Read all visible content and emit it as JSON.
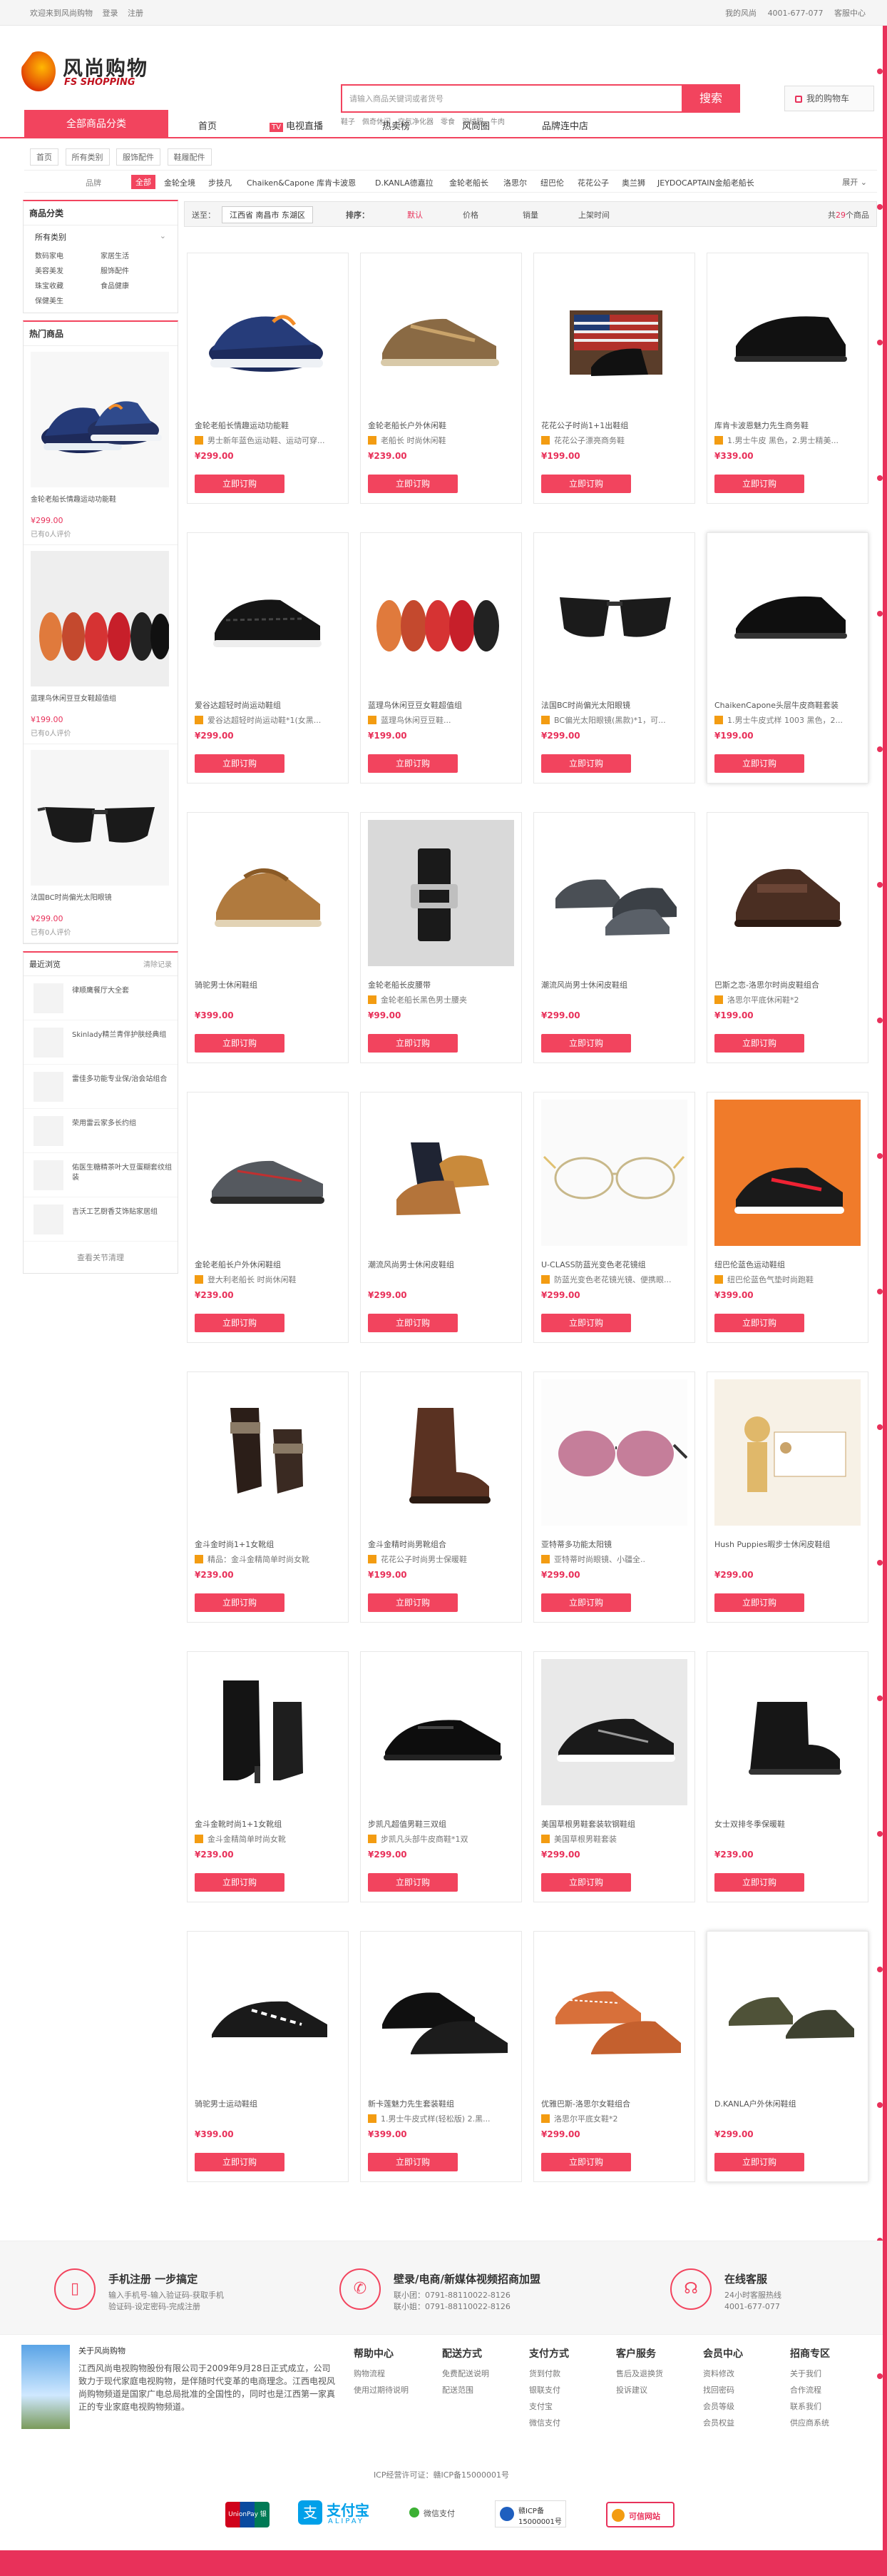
{
  "topbar": {
    "welcome": "欢迎来到风尚购物",
    "login": "登录",
    "register": "注册",
    "my_account": "我的风尚",
    "phone": "4001-677-077",
    "help": "客服中心"
  },
  "logo": {
    "cn": "风尚购物",
    "en": "FS SHOPPING"
  },
  "search": {
    "placeholder": "请输入商品关键词或者货号",
    "button": "搜索",
    "hot_words": [
      "鞋子",
      "佩奇休闲",
      "空气净化器",
      "零食",
      "羽绒服",
      "牛肉"
    ]
  },
  "cart": {
    "label": "我的购物车"
  },
  "nav": {
    "all_categories": "全部商品分类",
    "items": [
      "首页",
      "电视直播",
      "热卖榜",
      "风尚圈",
      "品牌连中店"
    ],
    "tv_badge": "TV"
  },
  "breadcrumb": [
    "首页",
    "所有类别",
    "服饰配件",
    "鞋履配件"
  ],
  "brands": {
    "label": "品牌",
    "selected": "全部",
    "items": [
      "金轮全境",
      "步技凡",
      "Chaiken&Capone 库肯卡波恩",
      "D.KANLA德嘉拉",
      "金轮老船长",
      "洛思尔",
      "纽巴伦",
      "花花公子",
      "奥兰狮",
      "JEYDOCAPTAIN金船老船长"
    ],
    "more": "展开"
  },
  "sidebar": {
    "category_title": "商品分类",
    "group": "所有类别",
    "links": [
      "数码家电",
      "家居生活",
      "美容美发",
      "服饰配件",
      "珠宝收藏",
      "食品健康",
      "保健美生"
    ],
    "hot_title": "热门商品",
    "hot_products": [
      {
        "name": "金轮老船长情趣运动功能鞋",
        "price": "¥299.00",
        "reviews": "已有0人评价"
      },
      {
        "name": "蓝理鸟休闲豆豆女鞋超值组",
        "price": "¥199.00",
        "reviews": "已有0人评价"
      },
      {
        "name": "法国BC时尚偏光太阳眼镜",
        "price": "¥299.00",
        "reviews": "已有0人评价"
      }
    ],
    "recent_title": "最近浏览",
    "recent_clear": "清除记录",
    "recent_items": [
      "律顺鹰餐厅大全套",
      "Skinlady精兰青伴护肤经典组",
      "雷佳多功能专业保/治会站组合",
      "荣用雷云家多长约组",
      "佑医生糖精茶叶大豆蛋糊套纹组装",
      "吉沃工艺厨香艾饰贴家居组"
    ],
    "recent_footer": "查看关节清理"
  },
  "sortbar": {
    "ship_to_label": "送至：",
    "location": "江西省 南昌市 东湖区",
    "sort_label": "排序：",
    "options": [
      "默认",
      "价格",
      "销量",
      "上架时间"
    ],
    "count_prefix": "共",
    "count": "29",
    "count_suffix": "个商品"
  },
  "buy_label": "立即订购",
  "products": [
    {
      "title": "金轮老船长情趣运动功能鞋",
      "tag": "男士新年蓝色运动鞋、运动可穿...",
      "price": "¥299.00"
    },
    {
      "title": "金轮老船长户外休闲鞋",
      "tag": "老船长 时尚休闲鞋",
      "price": "¥239.00"
    },
    {
      "title": "花花公子时尚1+1出鞋组",
      "tag": "花花公子漂亮商务鞋",
      "price": "¥199.00"
    },
    {
      "title": "库肯卡波恩魅力先生商务鞋",
      "tag": "1.男士牛皮 黑色，2.男士精美...",
      "price": "¥339.00"
    },
    {
      "title": "爱谷达超轻时尚运动鞋组",
      "tag": "爱谷达超轻时尚运动鞋*1(女黑...",
      "price": "¥299.00"
    },
    {
      "title": "蓝理鸟休闲豆豆女鞋超值组",
      "tag": "蓝理鸟休闲豆豆鞋...",
      "price": "¥199.00"
    },
    {
      "title": "法国BC时尚偏光太阳眼镜",
      "tag": "BC偏光太阳眼镜(黑款)*1，可...",
      "price": "¥299.00"
    },
    {
      "title": "ChaikenCapone头层牛皮商鞋套装",
      "tag": "1.男士牛皮式样 1003 黑色，2...",
      "price": "¥199.00"
    },
    {
      "title": "骑驼男士休闲鞋组",
      "tag": "",
      "price": "¥399.00"
    },
    {
      "title": "金轮老船长皮腰带",
      "tag": "金轮老船长黑色男士腰夹",
      "price": "¥99.00"
    },
    {
      "title": "潮流风尚男士休闲皮鞋组",
      "tag": "",
      "price": "¥299.00"
    },
    {
      "title": "巴斯之恋-洛思尔时尚皮鞋组合",
      "tag": "洛思尔平底休闲鞋*2",
      "price": "¥199.00"
    },
    {
      "title": "金轮老船长户外休闲鞋组",
      "tag": "登大利老船长 时尚休闲鞋",
      "price": "¥239.00"
    },
    {
      "title": "潮流风尚男士休闲皮鞋组",
      "tag": "",
      "price": "¥299.00"
    },
    {
      "title": "U-CLASS防蓝光变色老花镜组",
      "tag": "防蓝光变色老花镜光镜、便携眼...",
      "price": "¥299.00"
    },
    {
      "title": "纽巴伦蓝色运动鞋组",
      "tag": "纽巴伦蓝色气垫时尚跑鞋",
      "price": "¥399.00"
    },
    {
      "title": "金斗金时尚1+1女靴组",
      "tag": "精品：金斗金精简单时尚女靴",
      "price": "¥239.00"
    },
    {
      "title": "金斗金精时尚男靴组合",
      "tag": "花花公子时尚男士保暖鞋",
      "price": "¥199.00"
    },
    {
      "title": "亚特蒂多功能太阳镜",
      "tag": "亚特蒂时尚眼镜、小疆全..",
      "price": "¥299.00"
    },
    {
      "title": "Hush Puppies暇步士休闲皮鞋组",
      "tag": "",
      "price": "¥299.00"
    },
    {
      "title": "金斗金靴时尚1+1女靴组",
      "tag": "金斗金精简单时尚女靴",
      "price": "¥239.00"
    },
    {
      "title": "步凯凡超值男鞋三双组",
      "tag": "步凯凡头部牛皮商鞋*1双",
      "price": "¥299.00"
    },
    {
      "title": "美国草根男鞋套装软钢鞋组",
      "tag": "美国草根男鞋套装",
      "price": "¥299.00"
    },
    {
      "title": "女士双排冬季保暖鞋",
      "tag": "",
      "price": "¥239.00"
    },
    {
      "title": "骑驼男士运动鞋组",
      "tag": "",
      "price": "¥399.00"
    },
    {
      "title": "新卡莲魅力先生套装鞋组",
      "tag": "1.男士牛皮式样(轻松版) 2.黑...",
      "price": "¥399.00"
    },
    {
      "title": "优雅巴斯-洛思尔女鞋组合",
      "tag": "洛思尔平底女鞋*2",
      "price": "¥299.00"
    },
    {
      "title": "D.KANLA户外休闲鞋组",
      "tag": "",
      "price": "¥299.00"
    }
  ],
  "services": [
    {
      "title": "手机注册 一步搞定",
      "lines": [
        "输入手机号-输入验证码-获取手机",
        "验证码-设定密码-完成注册"
      ]
    },
    {
      "title": "壁录/电商/新媒体视频招商加盟",
      "lines": [
        "联小团：0791-88110022-8126",
        "联小姐：0791-88110022-8126"
      ]
    },
    {
      "title": "在线客服",
      "lines": [
        "24小时客服热线",
        "4001-677-077"
      ]
    }
  ],
  "about": {
    "title": "关于风尚购物",
    "text": "江西风尚电视购物股份有限公司于2009年9月28日正式成立，公司致力于现代家庭电视购物，是伴随时代变革的电商理念。江西电视风尚购物频道是国家广电总局批准的全国性的，同时也是江西第一家真正的专业家庭电视购物频道。"
  },
  "footer_columns": [
    {
      "title": "帮助中心",
      "links": [
        "购物流程",
        "使用过期待说明"
      ]
    },
    {
      "title": "配送方式",
      "links": [
        "免费配送说明",
        "配送范围"
      ]
    },
    {
      "title": "支付方式",
      "links": [
        "货到付款",
        "银联支付",
        "支付宝",
        "微信支付"
      ]
    },
    {
      "title": "客户服务",
      "links": [
        "售后及退换货",
        "投诉建议"
      ]
    },
    {
      "title": "会员中心",
      "links": [
        "资料修改",
        "找回密码",
        "会员等级",
        "会员权益"
      ]
    },
    {
      "title": "招商专区",
      "links": [
        "关于我们",
        "合作流程",
        "联系我们",
        "供应商系统"
      ]
    }
  ],
  "icp": "ICP经营许可证：赣ICP备15000001号",
  "payments": {
    "unionpay": "UnionPay 银联",
    "alipay_cn": "支付宝",
    "alipay_en": "ALIPAY",
    "wechat": "微信支付",
    "icp_badge_1": "赣ICP备",
    "icp_badge_2": "15000001号",
    "credit": "可信网站"
  },
  "colors": {
    "accent": "#f2445e",
    "price": "#e8315a",
    "tag": "#f39c12"
  }
}
